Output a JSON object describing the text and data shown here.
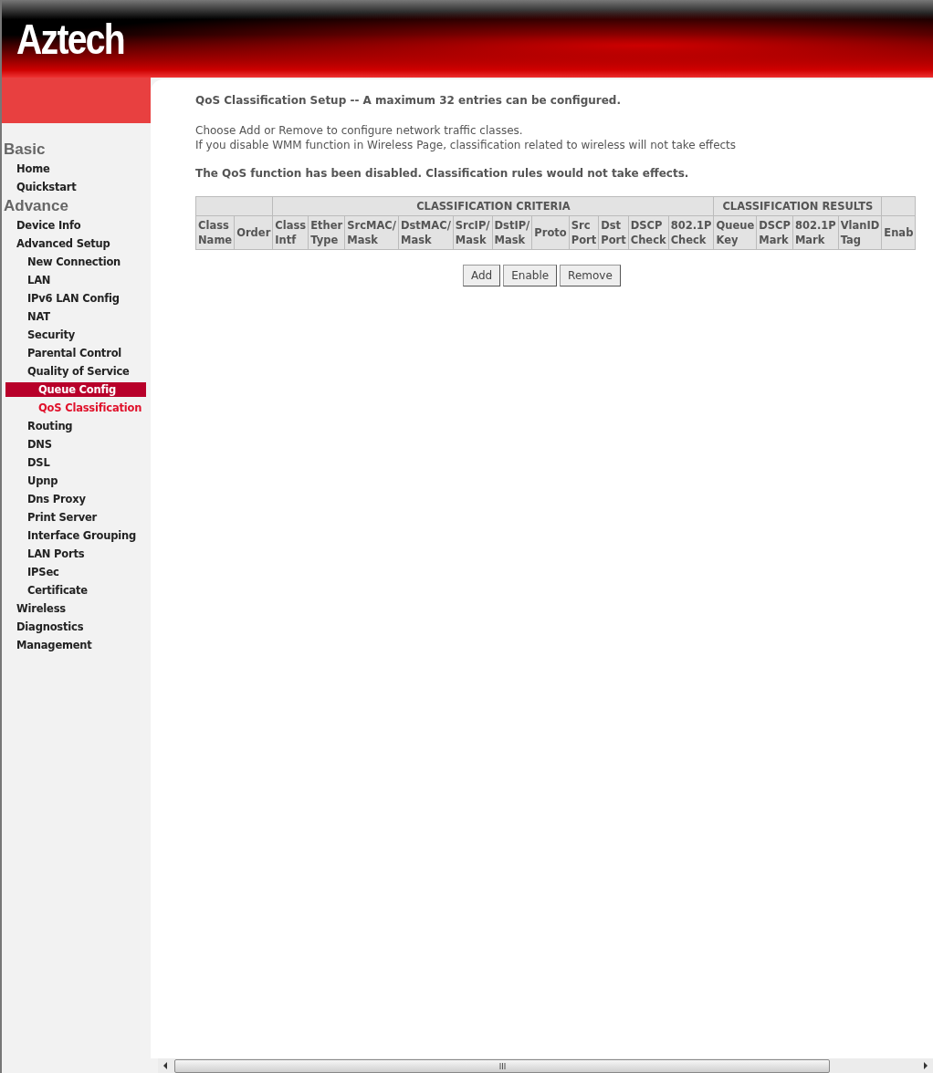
{
  "header": {
    "logo": "Aztech"
  },
  "sidebar": {
    "sections": [
      {
        "title": "Basic",
        "items": [
          {
            "label": "Home",
            "selected": false,
            "current": false
          },
          {
            "label": "Quickstart",
            "selected": false,
            "current": false
          }
        ]
      },
      {
        "title": "Advance",
        "items": [
          {
            "label": "Device Info",
            "selected": false,
            "current": false
          },
          {
            "label": "Advanced Setup",
            "selected": false,
            "current": false,
            "children": [
              {
                "label": "New Connection",
                "selected": false,
                "current": false
              },
              {
                "label": "LAN",
                "selected": false,
                "current": false
              },
              {
                "label": "IPv6 LAN Config",
                "selected": false,
                "current": false
              },
              {
                "label": "NAT",
                "selected": false,
                "current": false
              },
              {
                "label": "Security",
                "selected": false,
                "current": false
              },
              {
                "label": "Parental Control",
                "selected": false,
                "current": false
              },
              {
                "label": "Quality of Service",
                "selected": false,
                "current": false,
                "children": [
                  {
                    "label": "Queue Config",
                    "selected": true,
                    "current": false
                  },
                  {
                    "label": "QoS Classification",
                    "selected": false,
                    "current": true
                  }
                ]
              },
              {
                "label": "Routing",
                "selected": false,
                "current": false
              },
              {
                "label": "DNS",
                "selected": false,
                "current": false
              },
              {
                "label": "DSL",
                "selected": false,
                "current": false
              },
              {
                "label": "Upnp",
                "selected": false,
                "current": false
              },
              {
                "label": "Dns Proxy",
                "selected": false,
                "current": false
              },
              {
                "label": "Print Server",
                "selected": false,
                "current": false
              },
              {
                "label": "Interface Grouping",
                "selected": false,
                "current": false
              },
              {
                "label": "LAN Ports",
                "selected": false,
                "current": false
              },
              {
                "label": "IPSec",
                "selected": false,
                "current": false
              },
              {
                "label": "Certificate",
                "selected": false,
                "current": false
              }
            ]
          },
          {
            "label": "Wireless",
            "selected": false,
            "current": false
          },
          {
            "label": "Diagnostics",
            "selected": false,
            "current": false
          },
          {
            "label": "Management",
            "selected": false,
            "current": false
          }
        ]
      }
    ]
  },
  "content": {
    "title": "QoS Classification Setup -- A maximum 32 entries can be configured.",
    "instructions": [
      "Choose Add or Remove to configure network traffic classes.",
      "If you disable WMM function in Wireless Page, classification related to wireless will not take effects"
    ],
    "warning": "The QoS function has been disabled. Classification rules would not take effects.",
    "table": {
      "leading_columns": [
        [
          "Class",
          "Name"
        ],
        [
          "Order"
        ]
      ],
      "criteria": {
        "label": "CLASSIFICATION CRITERIA",
        "columns": [
          [
            "Class",
            "Intf"
          ],
          [
            "Ether",
            "Type"
          ],
          [
            "SrcMAC/",
            "Mask"
          ],
          [
            "DstMAC/",
            "Mask"
          ],
          [
            "SrcIP/",
            "Mask"
          ],
          [
            "DstIP/",
            "Mask"
          ],
          [
            "Proto"
          ],
          [
            "Src",
            "Port"
          ],
          [
            "Dst",
            "Port"
          ],
          [
            "DSCP",
            "Check"
          ],
          [
            "802.1P",
            "Check"
          ]
        ]
      },
      "results": {
        "label": "CLASSIFICATION RESULTS",
        "columns": [
          [
            "Queue",
            "Key"
          ],
          [
            "DSCP",
            "Mark"
          ],
          [
            "802.1P",
            "Mark"
          ],
          [
            "VlanID",
            "Tag"
          ]
        ]
      },
      "trailing_columns": [
        [
          "Enab"
        ]
      ]
    },
    "buttons": [
      "Add",
      "Enable",
      "Remove"
    ]
  }
}
